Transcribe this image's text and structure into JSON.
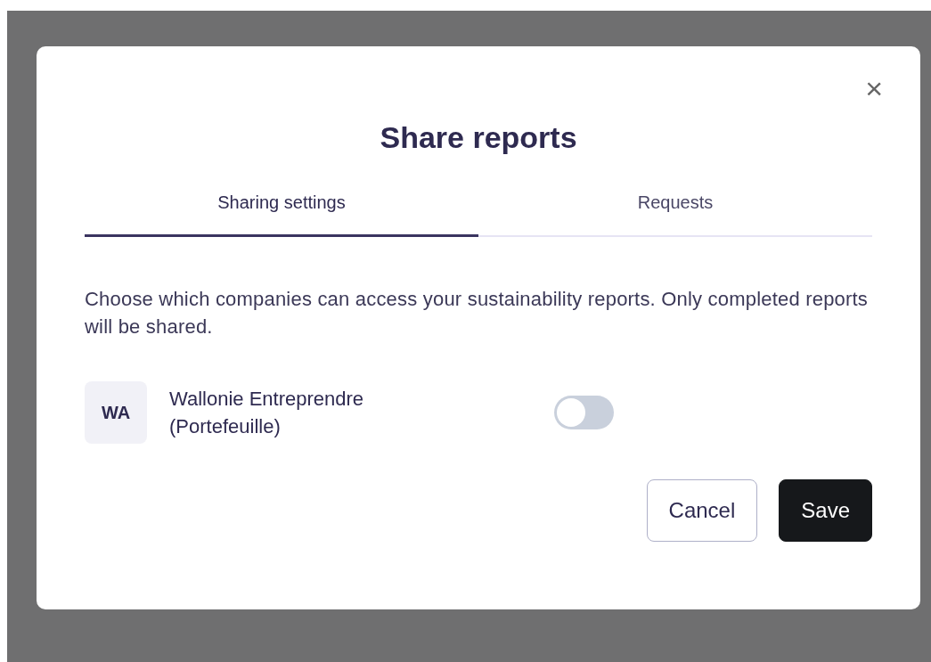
{
  "dialog": {
    "title": "Share reports",
    "close_label": "×",
    "tabs": [
      {
        "label": "Sharing settings",
        "selected": true
      },
      {
        "label": "Requests",
        "selected": false
      }
    ],
    "description": "Choose which companies can access your sustainability reports. Only completed reports will be shared.",
    "companies": [
      {
        "initials": "WA",
        "name": "Wallonie Entreprendre (Portefeuille)",
        "on": false
      }
    ],
    "buttons": [
      {
        "label": "Cancel",
        "kind": "secondary"
      },
      {
        "label": "Save",
        "kind": "primary"
      }
    ]
  }
}
